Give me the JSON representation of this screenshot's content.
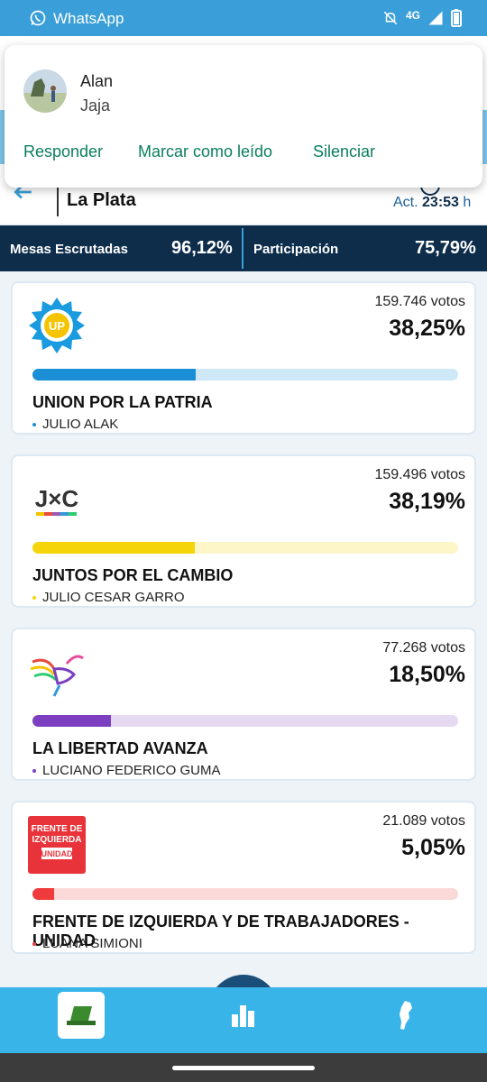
{
  "status_bar": {
    "app_name": "WhatsApp",
    "network": "4G"
  },
  "header": {
    "location": "La Plata",
    "update_label": "Act.",
    "update_time": "23:53",
    "update_suffix": "h"
  },
  "notification": {
    "sender": "Alan",
    "message": "Jaja",
    "actions": [
      "Responder",
      "Marcar como leído",
      "Silenciar"
    ]
  },
  "stats": {
    "mesas_label": "Mesas Escrutadas",
    "mesas_value": "96,12%",
    "participation_label": "Participación",
    "participation_value": "75,79%"
  },
  "results": [
    {
      "party": "UNION POR LA PATRIA",
      "candidate": "JULIO ALAK",
      "votes": "159.746 votos",
      "percent": "38,25%",
      "share": 0.3825,
      "color": "#1a8fd6",
      "track": "#cfe8f7"
    },
    {
      "party": "JUNTOS POR EL CAMBIO",
      "candidate": "JULIO CESAR GARRO",
      "votes": "159.496 votos",
      "percent": "38,19%",
      "share": 0.3819,
      "color": "#f5d50a",
      "track": "#fdf6c9"
    },
    {
      "party": "LA LIBERTAD AVANZA",
      "candidate": "LUCIANO FEDERICO GUMA",
      "votes": "77.268 votos",
      "percent": "18,50%",
      "share": 0.185,
      "color": "#7b3fbf",
      "track": "#e6d9f2"
    },
    {
      "party": "FRENTE DE IZQUIERDA Y DE TRABAJADORES - UNIDAD",
      "candidate": "LUANA SIMIONI",
      "votes": "21.089 votos",
      "percent": "5,05%",
      "share": 0.0505,
      "color": "#ef3b3b",
      "track": "#fbd9d9"
    }
  ],
  "logos": {
    "up_text": "UP",
    "jxc_text": "J×C",
    "fit_lines": [
      "FRENTE DE",
      "IZQUIERDA",
      "UNIDAD"
    ]
  },
  "icons": [
    "whatsapp-icon",
    "bell-off-icon",
    "signal-icon",
    "battery-icon",
    "back-arrow-icon",
    "clock-icon",
    "ballot-icon",
    "bar-chart-icon",
    "map-icon"
  ]
}
